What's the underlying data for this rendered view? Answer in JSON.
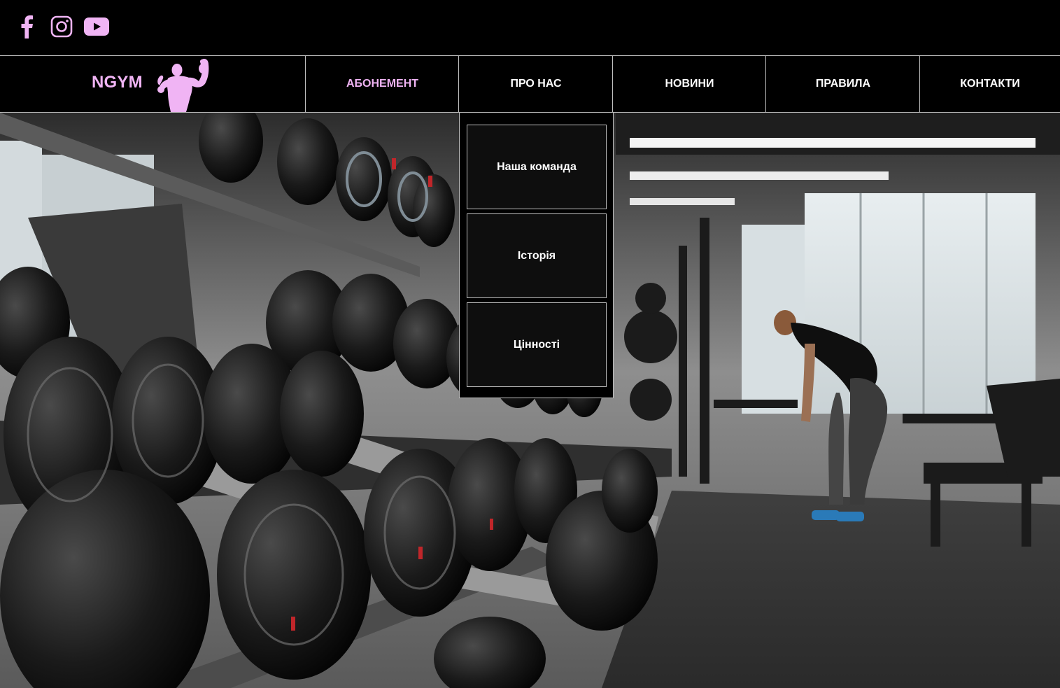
{
  "colors": {
    "accent": "#f0b4f4",
    "background": "#000000",
    "nav_text": "#ffffff",
    "border": "#bfbfbf"
  },
  "social": [
    {
      "name": "facebook-icon"
    },
    {
      "name": "instagram-icon"
    },
    {
      "name": "youtube-icon"
    }
  ],
  "brand": {
    "name": "NGYM",
    "logo_icon": "bodybuilder-flexing-icon"
  },
  "nav": {
    "items": [
      {
        "label": "АБОНЕМЕНТ",
        "active": true
      },
      {
        "label": "ПРО НАС"
      },
      {
        "label": "НОВИНИ"
      },
      {
        "label": "ПРАВИЛА"
      },
      {
        "label": "КОНТАКТИ"
      }
    ]
  },
  "dropdown": {
    "items": [
      {
        "label": "Наша команда"
      },
      {
        "label": "Історія"
      },
      {
        "label": "Цінності"
      }
    ]
  },
  "hero": {
    "image": "gym-dumbbell-rack-photo"
  }
}
